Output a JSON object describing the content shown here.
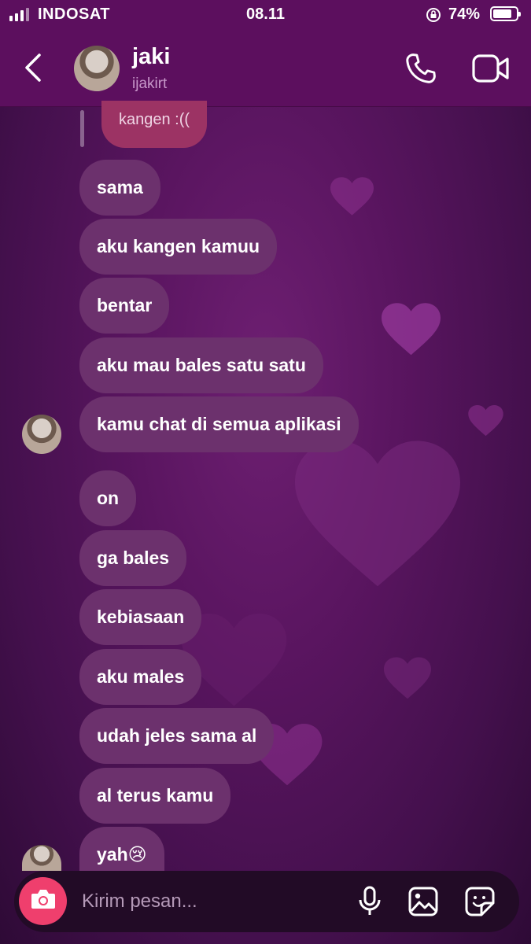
{
  "status_bar": {
    "carrier": "INDOSAT",
    "time": "08.11",
    "battery_pct": "74%"
  },
  "header": {
    "name": "jaki",
    "username": "ijakirt"
  },
  "replied_message": "kangen :((",
  "messages": [
    "sama",
    "aku kangen kamuu",
    "bentar",
    "aku mau bales satu satu",
    "kamu chat di semua aplikasi",
    "on",
    "ga bales",
    "kebiasaan",
    "aku males",
    "udah jeles sama al",
    "al terus kamu",
    "yah😢"
  ],
  "composer": {
    "placeholder": "Kirim pesan..."
  },
  "theme": {
    "accent": "#ef3f6d",
    "bubble": "#6c316d",
    "header": "#5c0f5e"
  },
  "icons": [
    "signal-icon",
    "rotation-lock-icon",
    "battery-icon",
    "back-chevron-icon",
    "phone-icon",
    "video-icon",
    "camera-icon",
    "microphone-icon",
    "gallery-icon",
    "sticker-icon"
  ]
}
